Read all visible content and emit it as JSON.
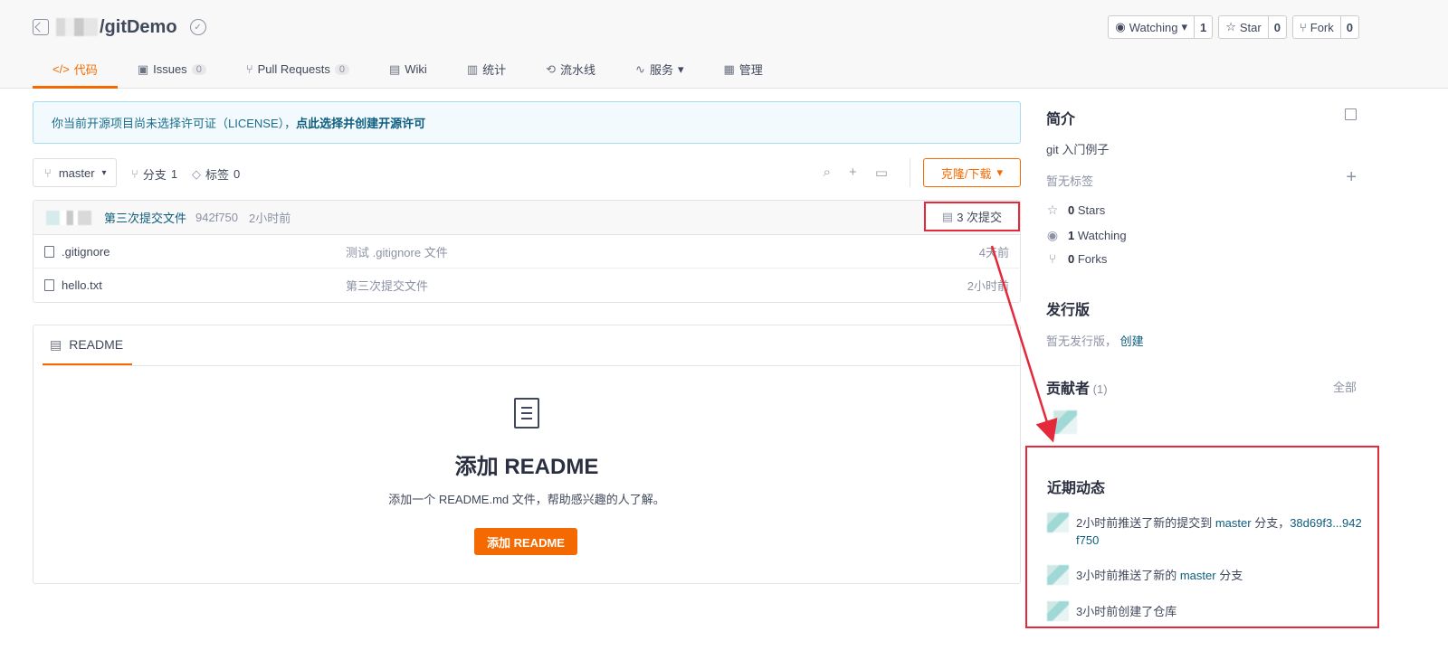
{
  "repo": {
    "name": "/gitDemo"
  },
  "actions": {
    "watching_label": "Watching",
    "watching_count": "1",
    "star_label": "Star",
    "star_count": "0",
    "fork_label": "Fork",
    "fork_count": "0"
  },
  "tabs": [
    {
      "label": "代码",
      "glyph": "</>",
      "active": true
    },
    {
      "label": "Issues",
      "glyph": "▣",
      "num": "0"
    },
    {
      "label": "Pull Requests",
      "glyph": "⑂",
      "num": "0"
    },
    {
      "label": "Wiki",
      "glyph": "▤"
    },
    {
      "label": "统计",
      "glyph": "▥"
    },
    {
      "label": "流水线",
      "glyph": "⟲"
    },
    {
      "label": "服务",
      "glyph": "∿",
      "dropdown": "▾"
    },
    {
      "label": "管理",
      "glyph": "▦"
    }
  ],
  "license": {
    "text": "你当前开源项目尚未选择许可证（LICENSE），",
    "link": "点此选择并创建开源许可"
  },
  "toolbar": {
    "branch": "master",
    "branches_label": "分支",
    "branches_count": "1",
    "tags_label": "标签",
    "tags_count": "0",
    "clone_label": "克隆/下载"
  },
  "latest_commit": {
    "message": "第三次提交文件",
    "hash": "942f750",
    "time": "2小时前",
    "count_label": "3 次提交"
  },
  "files": [
    {
      "name": ".gitignore",
      "message": "测试 .gitignore 文件",
      "time": "4天前"
    },
    {
      "name": "hello.txt",
      "message": "第三次提交文件",
      "time": "2小时前"
    }
  ],
  "readme": {
    "tab": "README",
    "heading": "添加 README",
    "description": "添加一个 README.md 文件，帮助感兴趣的人了解。",
    "button": "添加 README"
  },
  "sidebar": {
    "intro_title": "简介",
    "description": "git 入门例子",
    "no_tags": "暂无标签",
    "stars_count": "0",
    "stars_label": "Stars",
    "watching_count": "1",
    "watching_label": "Watching",
    "forks_count": "0",
    "forks_label": "Forks",
    "release_title": "发行版",
    "no_release": "暂无发行版，",
    "create_link": "创建",
    "contributors_title": "贡献者",
    "contributors_count": "(1)",
    "all_link": "全部",
    "activity_title": "近期动态",
    "activity": [
      {
        "pre": "2小时前推送了新的提交到 ",
        "branch": "master",
        "mid": " 分支，",
        "range": "38d69f3...942f750"
      },
      {
        "pre": "3小时前推送了新的 ",
        "branch": "master",
        "mid": " 分支",
        "range": ""
      },
      {
        "pre": "3小时前创建了仓库",
        "branch": "",
        "mid": "",
        "range": ""
      }
    ]
  },
  "colors": {
    "accent": "#f56a00",
    "highlight": "#e4293a",
    "link": "#0d5d7e"
  }
}
